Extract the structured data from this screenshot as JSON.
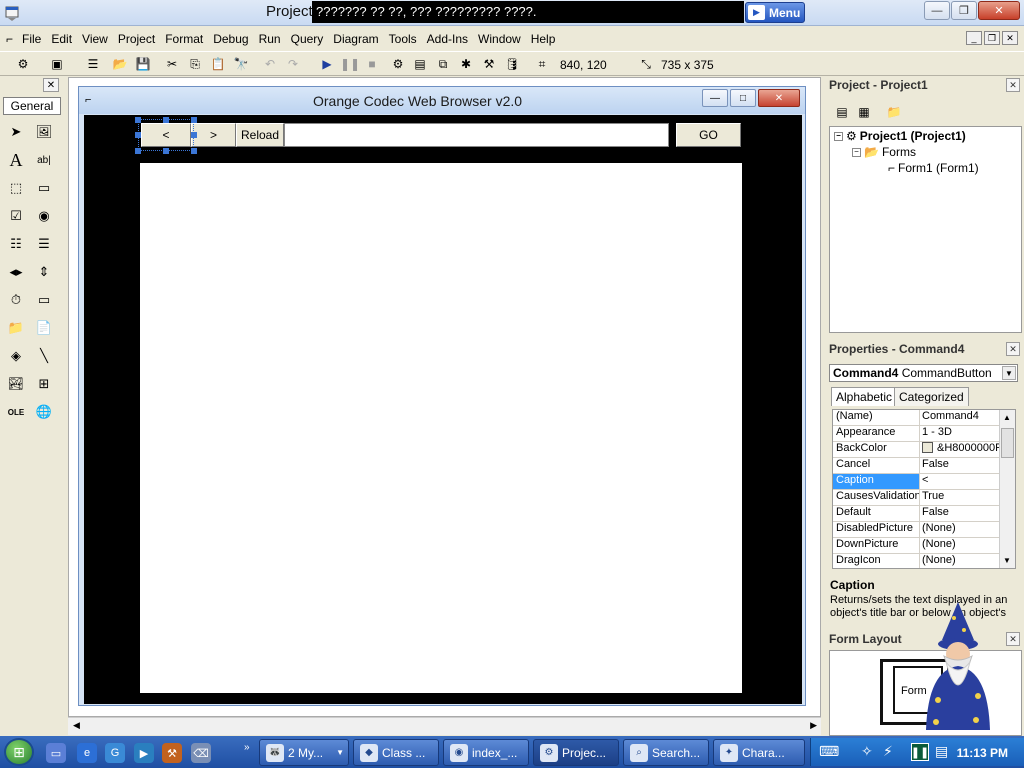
{
  "titlebar": {
    "title": "Project",
    "title_overlay": "??????? ?? ??, ??? ????????? ????.",
    "menu_button": "Menu"
  },
  "menubar": [
    "File",
    "Edit",
    "View",
    "Project",
    "Format",
    "Debug",
    "Run",
    "Query",
    "Diagram",
    "Tools",
    "Add-Ins",
    "Window",
    "Help"
  ],
  "toolbar": {
    "position": "840, 120",
    "size": "735 x 375"
  },
  "toolbox": {
    "tab_label": "General"
  },
  "form": {
    "title": "Orange Codec Web Browser v2.0",
    "back_caption": "<",
    "forward_caption": ">",
    "reload_caption": "Reload",
    "url_value": "",
    "go_caption": "GO"
  },
  "project_panel": {
    "title": "Project - Project1",
    "root": "Project1 (Project1)",
    "folder": "Forms",
    "item": "Form1 (Form1)"
  },
  "properties_panel": {
    "title": "Properties - Command4",
    "object_name": "Command4",
    "object_type": "CommandButton",
    "tab_alpha": "Alphabetic",
    "tab_cat": "Categorized",
    "rows": [
      {
        "name": "(Name)",
        "value": "Command4"
      },
      {
        "name": "Appearance",
        "value": "1 - 3D"
      },
      {
        "name": "BackColor",
        "value": "&H8000000F"
      },
      {
        "name": "Cancel",
        "value": "False"
      },
      {
        "name": "Caption",
        "value": "<"
      },
      {
        "name": "CausesValidation",
        "value": "True"
      },
      {
        "name": "Default",
        "value": "False"
      },
      {
        "name": "DisabledPicture",
        "value": "(None)"
      },
      {
        "name": "DownPicture",
        "value": "(None)"
      },
      {
        "name": "DragIcon",
        "value": "(None)"
      }
    ],
    "selected_row": 4,
    "desc_title": "Caption",
    "desc_text": "Returns/sets the text displayed in an object's title bar or below an object's"
  },
  "layout_panel": {
    "title": "Form Layout",
    "form_label": "Form"
  },
  "taskbar": {
    "tasks": [
      {
        "label": "2 My...",
        "icon": "raccoon-icon"
      },
      {
        "label": "Class ...",
        "icon": "class-icon"
      },
      {
        "label": "index_...",
        "icon": "browser-icon"
      },
      {
        "label": "Projec...",
        "icon": "vb-icon"
      },
      {
        "label": "Search...",
        "icon": "search-icon"
      },
      {
        "label": "Chara...",
        "icon": "character-icon"
      }
    ],
    "clock": "11:13 PM"
  },
  "colors": {
    "selection": "#3399ff",
    "taskbar": "#1f4fa3",
    "form_client": "#000000"
  }
}
